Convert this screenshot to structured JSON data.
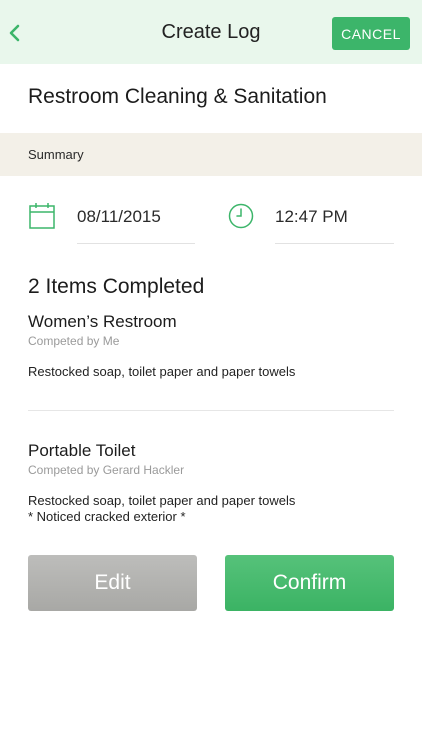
{
  "header": {
    "title": "Create Log",
    "cancel_label": "CANCEL",
    "back_icon": "chevron-left-icon",
    "accent_color": "#3cb56a",
    "background_color": "#e9f7ec"
  },
  "log": {
    "title": "Restroom Cleaning & Sanitation"
  },
  "summary": {
    "label": "Summary",
    "date": "08/11/2015",
    "time": "12:47 PM",
    "date_icon": "calendar-icon",
    "time_icon": "clock-icon"
  },
  "completed": {
    "title": "2 Items Completed",
    "items": [
      {
        "name": "Women’s Restroom",
        "completed_by": "Competed by Me",
        "note_lines": [
          "Restocked soap, toilet paper and paper towels"
        ]
      },
      {
        "name": "Portable Toilet",
        "completed_by": "Competed by Gerard Hackler",
        "note_lines": [
          "Restocked soap, toilet paper and paper towels",
          "* Noticed cracked exterior *"
        ]
      }
    ]
  },
  "actions": {
    "edit_label": "Edit",
    "confirm_label": "Confirm"
  }
}
